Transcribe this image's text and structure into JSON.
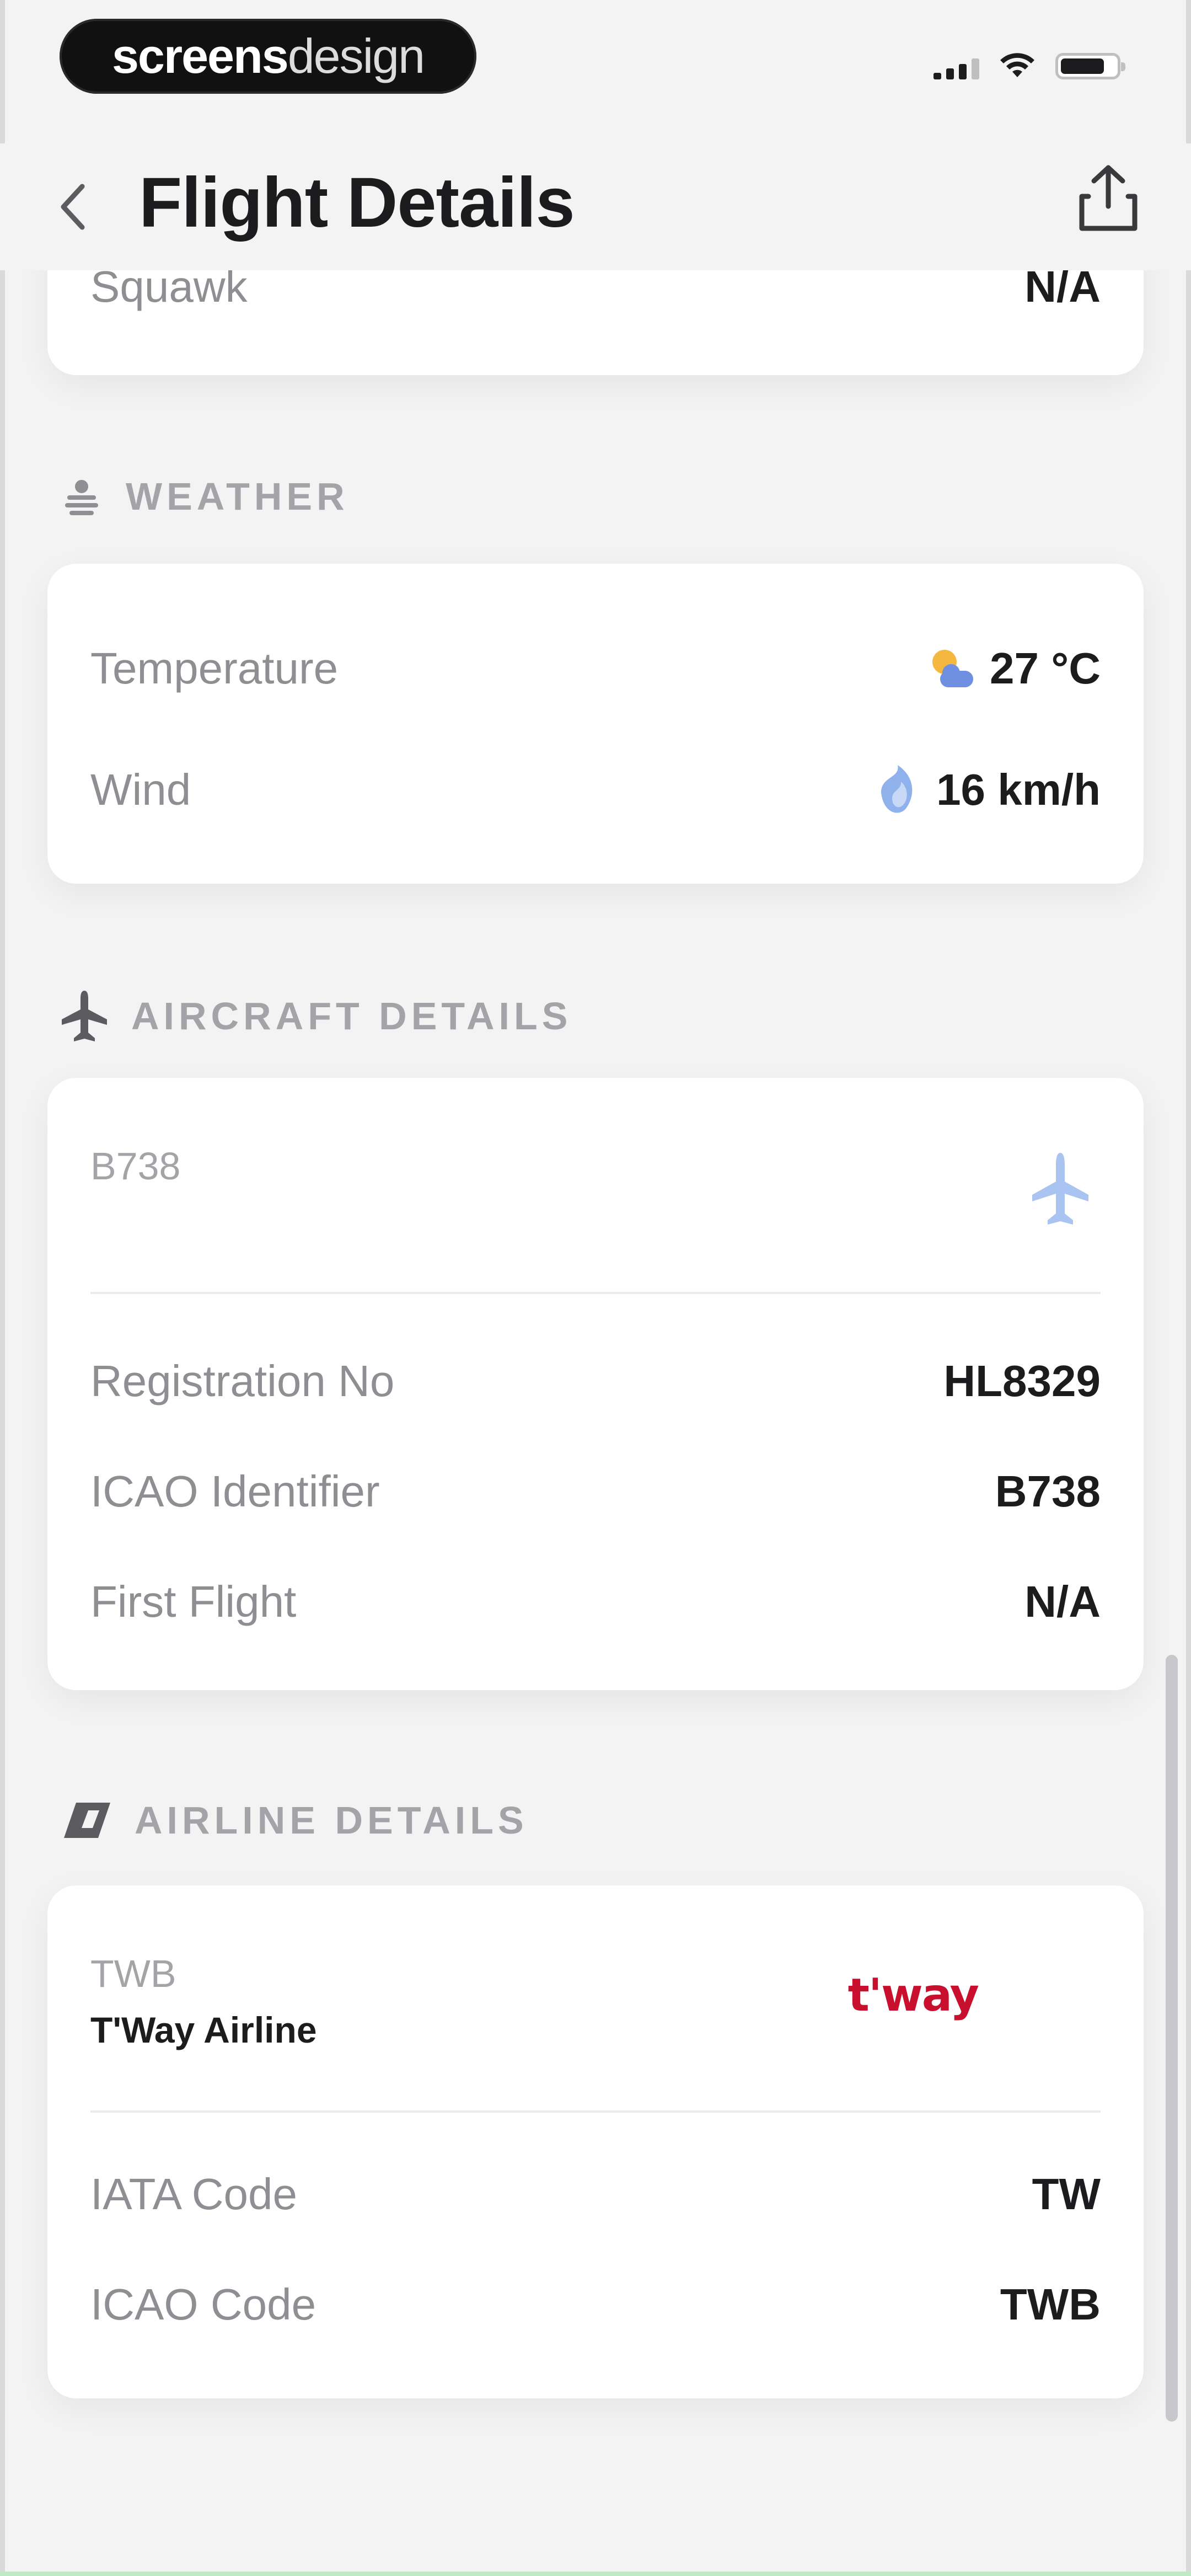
{
  "watermark": {
    "part1": "screens",
    "part2": "design"
  },
  "nav": {
    "title": "Flight Details"
  },
  "top_card": {
    "label": "Squawk",
    "value": "N/A"
  },
  "weather": {
    "section_title": "WEATHER",
    "temperature_label": "Temperature",
    "temperature_value": "27 °C",
    "wind_label": "Wind",
    "wind_value": "16 km/h"
  },
  "aircraft": {
    "section_title": "AIRCRAFT DETAILS",
    "type_code": "B738",
    "registration_label": "Registration No",
    "registration_value": "HL8329",
    "icao_label": "ICAO Identifier",
    "icao_value": "B738",
    "first_flight_label": "First Flight",
    "first_flight_value": "N/A"
  },
  "airline": {
    "section_title": "AIRLINE DETAILS",
    "code": "TWB",
    "name": "T'Way Airline",
    "logo_text": "t'way",
    "iata_label": "IATA Code",
    "iata_value": "TW",
    "icao_label": "ICAO Code",
    "icao_value": "TWB"
  },
  "colors": {
    "accent_blue": "#7fa8e8",
    "brand_red": "#c8102e"
  }
}
